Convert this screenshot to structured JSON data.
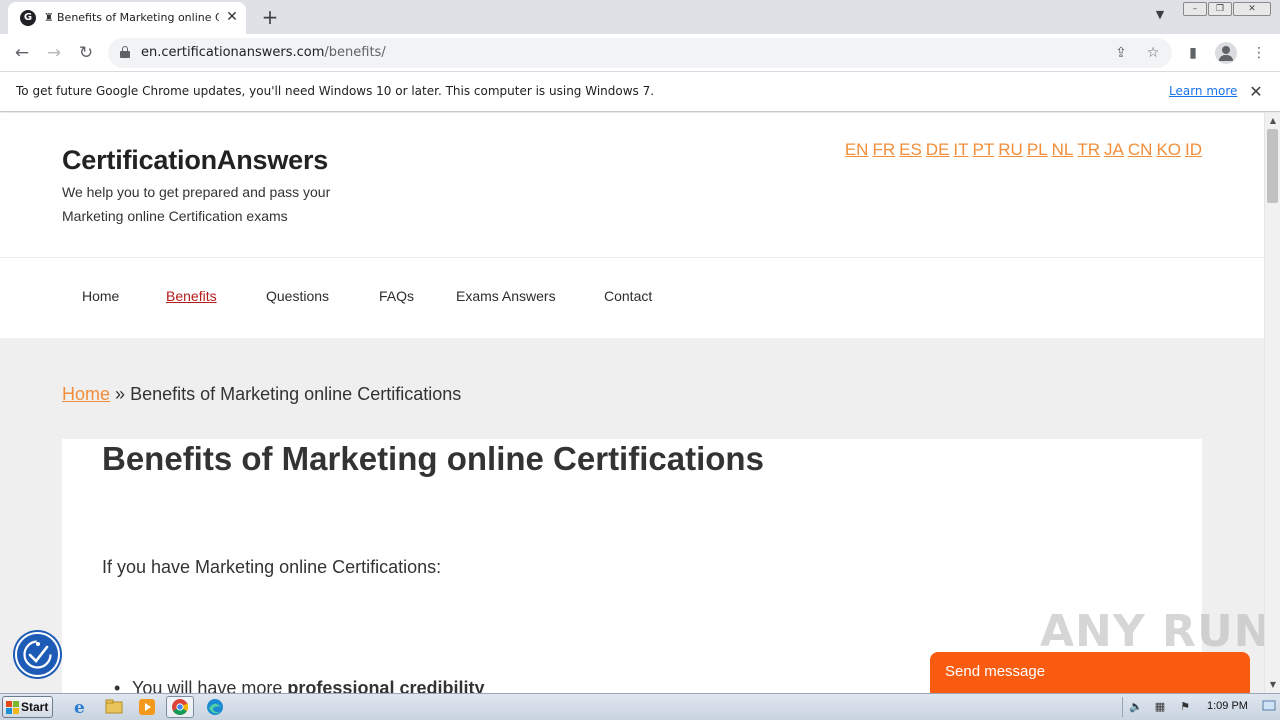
{
  "browser": {
    "tab": {
      "favicon_letter": "G",
      "title": "Benefits of Marketing online Certifications"
    },
    "address": {
      "domain": "en.certificationanswers.com",
      "path": "/benefits/"
    },
    "infobar": {
      "message": "To get future Google Chrome updates, you'll need Windows 10 or later. This computer is using Windows 7.",
      "link": "Learn more"
    }
  },
  "site": {
    "title": "CertificationAnswers",
    "tagline": "We help you to get prepared and pass your Marketing online Certification exams",
    "languages": [
      "EN",
      "FR",
      "ES",
      "DE",
      "IT",
      "PT",
      "RU",
      "PL",
      "NL",
      "TR",
      "JA",
      "CN",
      "KO",
      "ID"
    ],
    "nav": {
      "home": "Home",
      "benefits": "Benefits",
      "questions": "Questions",
      "faqs": "FAQs",
      "exams": "Exams Answers",
      "contact": "Contact"
    },
    "breadcrumb": {
      "home": "Home",
      "separator": "»",
      "current": "Benefits of Marketing online Certifications"
    },
    "article": {
      "title": "Benefits of Marketing online Certifications",
      "intro": "If you have Marketing online Certifications:",
      "bullet_prefix": "You will have more ",
      "bullet_bold": "professional credibility"
    },
    "chat": {
      "label": "Send message"
    },
    "watermark": "ANY RUN"
  },
  "taskbar": {
    "start_label": "Start",
    "clock": "1:09 PM"
  },
  "colors": {
    "accent_orange": "#f28e3a",
    "nav_active": "#b41c1c",
    "chat_bg": "#f95c10",
    "a11y_blue": "#1d5bb6"
  }
}
